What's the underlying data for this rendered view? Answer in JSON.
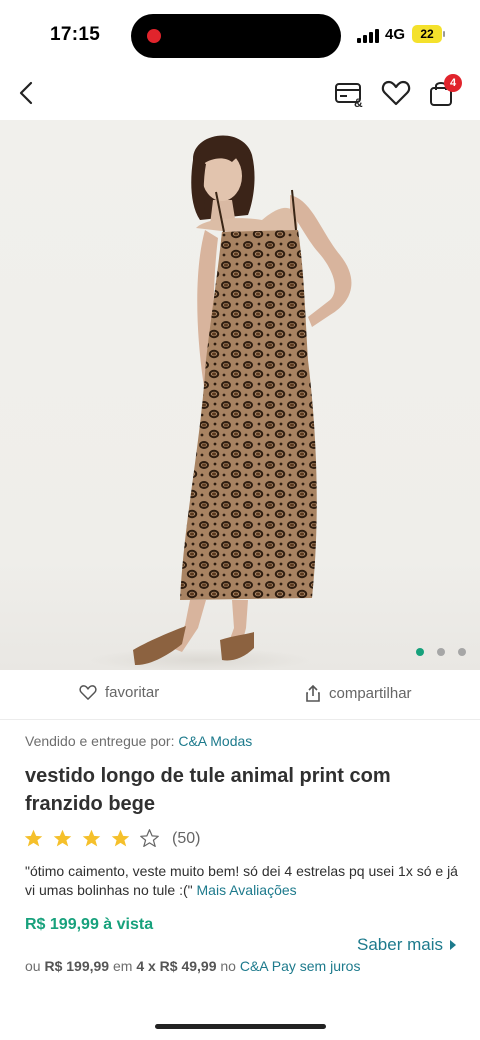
{
  "status_bar": {
    "time": "17:15",
    "network": "4G",
    "battery": "22"
  },
  "nav": {
    "cart_count": "4",
    "icons": [
      "chevron-left-icon",
      "card-payment-icon",
      "heart-icon",
      "shopping-bag-icon"
    ]
  },
  "gallery": {
    "active_index": 0,
    "total": 3
  },
  "actions": {
    "favorite_label": "favoritar",
    "share_label": "compartilhar"
  },
  "seller": {
    "prefix": "Vendido e entregue por:",
    "name": "C&A Modas"
  },
  "product": {
    "title": "vestido longo de tule animal print com franzido bege",
    "rating_value": 4,
    "rating_max": 5,
    "rating_count": "(50)",
    "review_text": "\"ótimo caimento, veste muito bem! só dei 4 estrelas pq usei 1x só e já vi umas bolinhas no tule :(\"",
    "review_link": "Mais Avaliações"
  },
  "pricing": {
    "cash_price": "R$ 199,99 à vista",
    "saber_mais": "Saber mais",
    "inst_ou": "ou",
    "inst_total": "R$ 199,99",
    "inst_em": "em",
    "inst_parcelas": "4 x R$ 49,99",
    "inst_no": "no",
    "inst_link": "C&A Pay sem juros"
  },
  "colors": {
    "accent_teal": "#1d7a8c",
    "price_green": "#17a17c",
    "badge_red": "#e1242c",
    "star_yellow": "#f5c02b"
  }
}
